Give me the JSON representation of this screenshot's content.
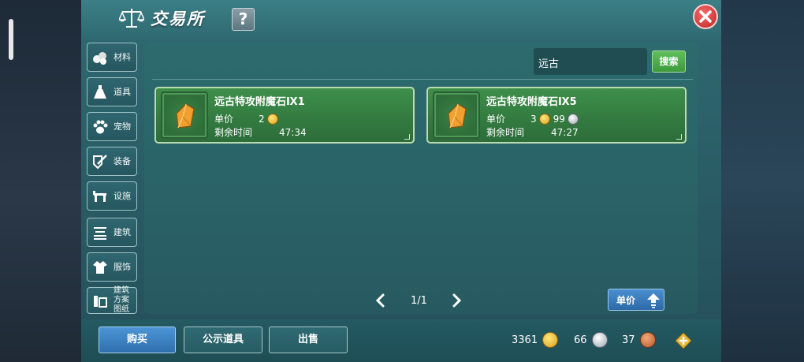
{
  "title": "交易所",
  "help_label": "?",
  "sidebar": {
    "items": [
      {
        "label": "材料",
        "icon": "materials-icon"
      },
      {
        "label": "道具",
        "icon": "potion-icon"
      },
      {
        "label": "宠物",
        "icon": "paw-icon"
      },
      {
        "label": "装备",
        "icon": "equipment-icon"
      },
      {
        "label": "设施",
        "icon": "facility-icon"
      },
      {
        "label": "建筑",
        "icon": "building-icon"
      },
      {
        "label": "服饰",
        "icon": "clothing-icon"
      },
      {
        "label": "建筑方案图纸",
        "icon": "blueprint-icon"
      }
    ]
  },
  "search": {
    "value": "远古",
    "button_label": "搜索"
  },
  "listings": [
    {
      "name": "远古特攻附魔石Ⅸ1",
      "price_label": "单价",
      "price_gold": "2",
      "price_silver": "",
      "time_label": "剩余时间",
      "time_left": "47:34"
    },
    {
      "name": "远古特攻附魔石Ⅸ5",
      "price_label": "单价",
      "price_gold": "3",
      "price_silver": "99",
      "time_label": "剩余时间",
      "time_left": "47:27"
    }
  ],
  "pager": {
    "text": "1/1"
  },
  "sort_label": "单价",
  "bottom_tabs": [
    {
      "label": "购买",
      "active": true
    },
    {
      "label": "公示道具",
      "active": false
    },
    {
      "label": "出售",
      "active": false
    }
  ],
  "currency": {
    "gold": "3361",
    "silver": "66",
    "bronze": "37"
  },
  "colors": {
    "panel": "#2a6368",
    "card_green": "#3e8f4a",
    "active_tab_blue": "#4c95d6",
    "search_green": "#5fbf5a",
    "close_red": "#c42424"
  }
}
